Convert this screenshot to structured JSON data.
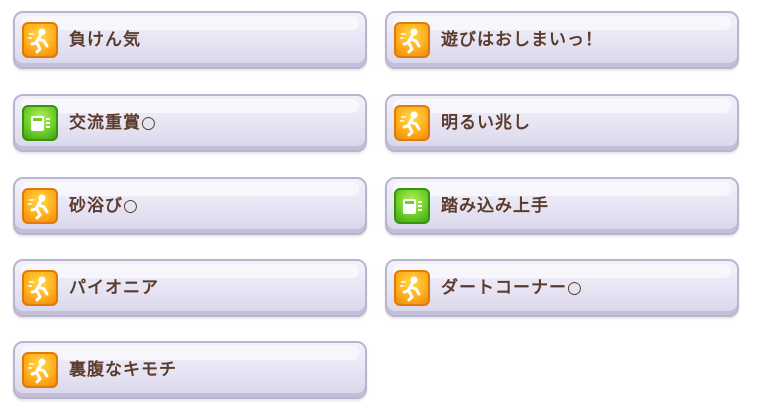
{
  "skills": [
    {
      "label": "負けん気",
      "icon": "orange-speed-runner-icon",
      "color": "orange"
    },
    {
      "label": "遊びはおしまいっ！",
      "icon": "orange-speed-runner-icon",
      "color": "orange"
    },
    {
      "label": "交流重賞○",
      "icon": "green-passive-card-icon",
      "color": "green"
    },
    {
      "label": "明るい兆し",
      "icon": "orange-speed-runner-icon",
      "color": "orange"
    },
    {
      "label": "砂浴び○",
      "icon": "orange-speed-runner-icon",
      "color": "orange"
    },
    {
      "label": "踏み込み上手",
      "icon": "green-passive-card-icon",
      "color": "green"
    },
    {
      "label": "パイオニア",
      "icon": "orange-speed-runner-icon",
      "color": "orange"
    },
    {
      "label": "ダートコーナー○",
      "icon": "orange-speed-runner-icon",
      "color": "orange"
    },
    {
      "label": "裏腹なキモチ",
      "icon": "orange-speed-runner-icon",
      "color": "orange"
    }
  ],
  "colors": {
    "text": "#5b3b2b",
    "orange_icon": "#ffb01e",
    "green_icon": "#6fcf2a",
    "card_border": "#b9b5cf"
  }
}
